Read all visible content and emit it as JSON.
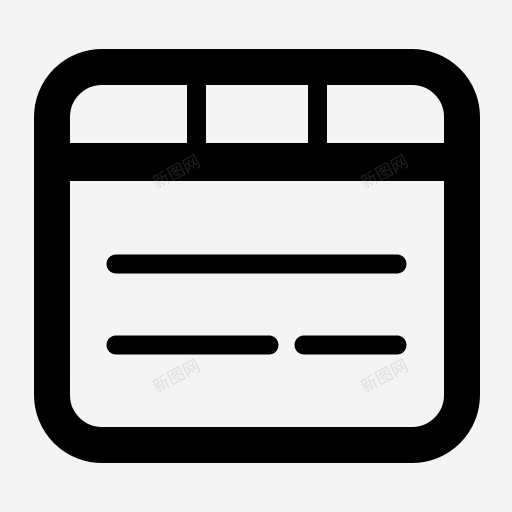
{
  "icon": {
    "name": "table-layout-icon",
    "stroke_color": "#000000",
    "fill_color": "#f4f4f4",
    "background": "#f4f4f4"
  },
  "watermark": {
    "text": "新图网"
  }
}
